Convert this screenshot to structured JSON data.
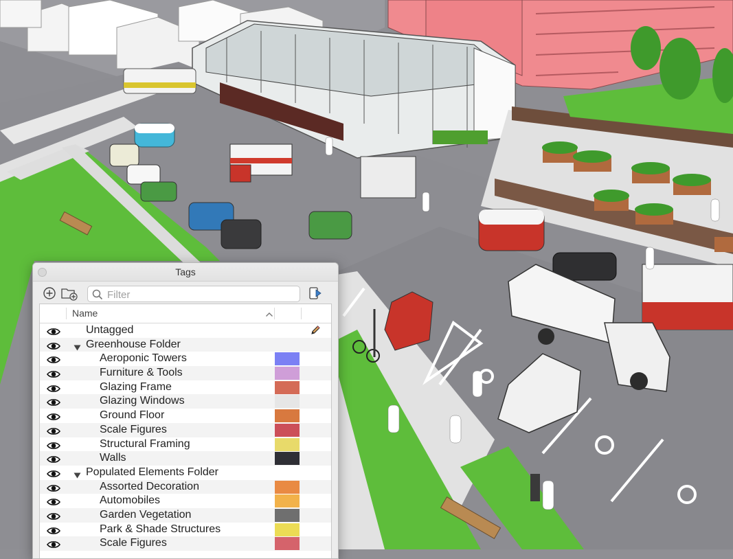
{
  "panel": {
    "title": "Tags",
    "filter_placeholder": "Filter",
    "column_name": "Name"
  },
  "icons": {
    "close": "close-dot-icon",
    "add": "add-tag-icon",
    "folder": "add-folder-icon",
    "search": "search-icon",
    "details": "details-toggle-icon",
    "sort": "sort-ascending-icon",
    "eye": "eye-icon",
    "pencil": "pencil-icon",
    "triangle": "disclosure-triangle-icon"
  },
  "rows": [
    {
      "label": "Untagged",
      "level": 0,
      "type": "untagged",
      "color": null
    },
    {
      "label": "Greenhouse Folder",
      "level": 0,
      "type": "folder",
      "color": null
    },
    {
      "label": "Aeroponic Towers",
      "level": 1,
      "type": "tag",
      "color": "#7b80f4"
    },
    {
      "label": "Furniture & Tools",
      "level": 1,
      "type": "tag",
      "color": "#cf9ed8"
    },
    {
      "label": "Glazing Frame",
      "level": 1,
      "type": "tag",
      "color": "#d46b57"
    },
    {
      "label": "Glazing Windows",
      "level": 1,
      "type": "tag",
      "color": "#e6e6e6"
    },
    {
      "label": "Ground Floor",
      "level": 1,
      "type": "tag",
      "color": "#d8793f"
    },
    {
      "label": "Scale Figures",
      "level": 1,
      "type": "tag",
      "color": "#cc4f59"
    },
    {
      "label": "Structural Framing",
      "level": 1,
      "type": "tag",
      "color": "#e8da6a"
    },
    {
      "label": "Walls",
      "level": 1,
      "type": "tag",
      "color": "#2f2f35"
    },
    {
      "label": "Populated Elements Folder",
      "level": 0,
      "type": "folder",
      "color": null
    },
    {
      "label": "Assorted Decoration",
      "level": 1,
      "type": "tag",
      "color": "#e98a43"
    },
    {
      "label": "Automobiles",
      "level": 1,
      "type": "tag",
      "color": "#f2b24a"
    },
    {
      "label": "Garden Vegetation",
      "level": 1,
      "type": "tag",
      "color": "#6f6f6f"
    },
    {
      "label": "Park & Shade Structures",
      "level": 1,
      "type": "tag",
      "color": "#ecdc55"
    },
    {
      "label": "Scale Figures",
      "level": 1,
      "type": "tag",
      "color": "#d5636b"
    }
  ]
}
